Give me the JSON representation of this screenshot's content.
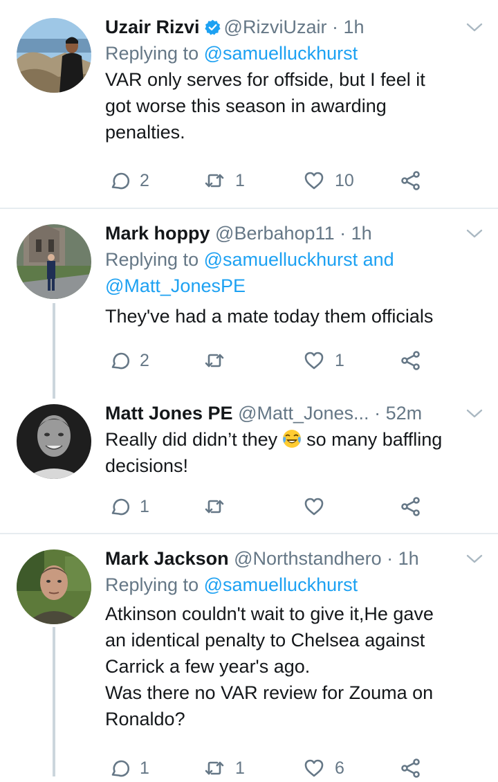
{
  "colors": {
    "link": "#1da1f2",
    "secondary": "#657786",
    "divider": "#e6ecf0",
    "thread": "#ccd6dd"
  },
  "tweets": [
    {
      "name": "Uzair Rizvi",
      "verified": true,
      "handle": "@RizviUzair",
      "time": "1h",
      "replying_prefix": "Replying to",
      "replying_to": "@samuelluckhurst",
      "text_lines": [
        "VAR only serves for offside, but I feel it",
        "got worse this season in awarding",
        "penalties."
      ],
      "replies": "2",
      "retweets": "1",
      "likes": "10"
    },
    {
      "name": "Mark hoppy",
      "handle": "@Berbahop11",
      "time": "1h",
      "replying_prefix": "Replying to",
      "replying_to_line1": "@samuelluckhurst and",
      "replying_to_line2": "@Matt_JonesPE",
      "text_lines": [
        "They've had a mate today them officials"
      ],
      "replies": "2",
      "retweets": "",
      "likes": "1"
    },
    {
      "name": "Matt Jones PE",
      "handle": "@Matt_Jones...",
      "time": "52m",
      "text_line1_before": "Really did didn’t they",
      "emoji": "face-with-tears-of-joy",
      "text_line1_after": "so many baffling",
      "text_line2": "decisions!",
      "replies": "1",
      "retweets": "",
      "likes": ""
    },
    {
      "name": "Mark Jackson",
      "handle": "@Northstandhero",
      "time": "1h",
      "replying_prefix": "Replying to",
      "replying_to": "@samuelluckhurst",
      "text_lines": [
        "Atkinson couldn't wait to give it,He gave",
        "an identical penalty to Chelsea against",
        "Carrick a few year's ago.",
        "Was there no VAR review for Zouma on",
        "Ronaldo?"
      ],
      "replies": "1",
      "retweets": "1",
      "likes": "6"
    }
  ]
}
